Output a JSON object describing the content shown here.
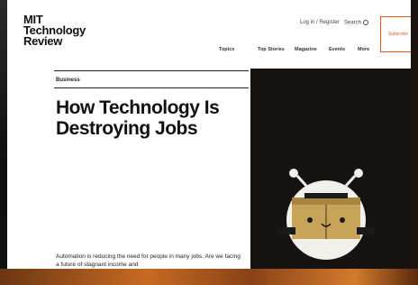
{
  "site": {
    "logo_lines": [
      "MIT",
      "Technology",
      "Review"
    ]
  },
  "header": {
    "login": "Log in / Register",
    "search": "Search",
    "subscribe": "Subscribe"
  },
  "nav": {
    "items": [
      "Topics",
      "Top Stories",
      "Magazine",
      "Events",
      "More"
    ]
  },
  "article": {
    "category": "Business",
    "headline": "How Technology Is Destroying Jobs",
    "deck": "Automation is reducing the need for people in many jobs. Are we facing a future of stagnant income and"
  },
  "colors": {
    "accent": "#e85a2e",
    "hero_bg": "#15120f",
    "robot_box": "#c8a45a"
  },
  "icons": [
    "search-icon",
    "robot-illustration"
  ]
}
